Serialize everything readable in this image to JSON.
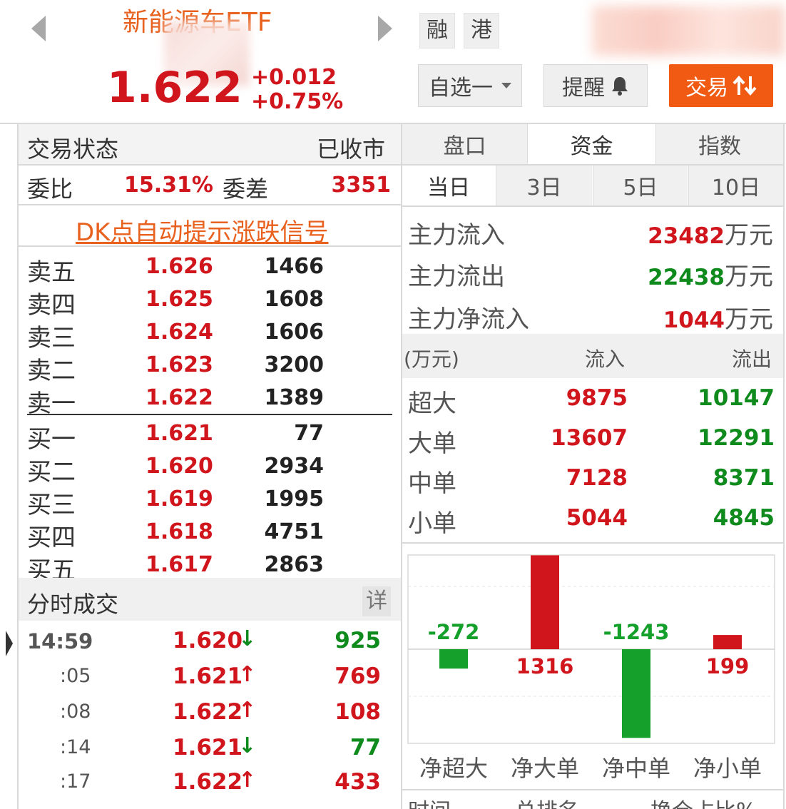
{
  "header": {
    "title": "新能源车ETF",
    "price": "1.622",
    "change": "+0.012",
    "change_pct": "+0.75%",
    "tag_margin": "融",
    "tag_hk": "港",
    "watchlist_label": "自选一",
    "alert_label": "提醒",
    "trade_label": "交易"
  },
  "status": {
    "label": "交易状态",
    "value": "已收市",
    "ratio_label": "委比",
    "ratio_value": "15.31%",
    "diff_label": "委差",
    "diff_value": "3351",
    "signal_link": "DK点自动提示涨跌信号"
  },
  "orderbook": {
    "asks": [
      {
        "name": "卖五",
        "price": "1.626",
        "vol": "1466"
      },
      {
        "name": "卖四",
        "price": "1.625",
        "vol": "1608"
      },
      {
        "name": "卖三",
        "price": "1.624",
        "vol": "1606"
      },
      {
        "name": "卖二",
        "price": "1.623",
        "vol": "3200"
      },
      {
        "name": "卖一",
        "price": "1.622",
        "vol": "1389"
      }
    ],
    "bids": [
      {
        "name": "买一",
        "price": "1.621",
        "vol": "77"
      },
      {
        "name": "买二",
        "price": "1.620",
        "vol": "2934"
      },
      {
        "name": "买三",
        "price": "1.619",
        "vol": "1995"
      },
      {
        "name": "买四",
        "price": "1.618",
        "vol": "4751"
      },
      {
        "name": "买五",
        "price": "1.617",
        "vol": "2863"
      }
    ]
  },
  "ticks": {
    "title": "分时成交",
    "detail": "详",
    "rows": [
      {
        "time": "14:59",
        "price": "1.620",
        "dir": "↓",
        "vol": "925",
        "color": "#0f8a1c"
      },
      {
        "time": ":05",
        "price": "1.621",
        "dir": "↑",
        "vol": "769",
        "color": "#d0161c"
      },
      {
        "time": ":08",
        "price": "1.622",
        "dir": "↑",
        "vol": "108",
        "color": "#d0161c"
      },
      {
        "time": ":14",
        "price": "1.621",
        "dir": "↓",
        "vol": "77",
        "color": "#0f8a1c"
      },
      {
        "time": ":17",
        "price": "1.622",
        "dir": "↑",
        "vol": "433",
        "color": "#d0161c"
      }
    ]
  },
  "tabs": {
    "main": [
      "盘口",
      "资金",
      "指数"
    ],
    "period": [
      "当日",
      "3日",
      "5日",
      "10日"
    ]
  },
  "fundflow": {
    "inflow_label": "主力流入",
    "inflow_value": "23482",
    "outflow_label": "主力流出",
    "outflow_value": "22438",
    "net_label": "主力净流入",
    "net_value": "1044",
    "unit": "万元",
    "table_unit": "(万元)",
    "col_in": "流入",
    "col_out": "流出",
    "rows": [
      {
        "name": "超大",
        "in": "9875",
        "out": "10147"
      },
      {
        "name": "大单",
        "in": "13607",
        "out": "12291"
      },
      {
        "name": "中单",
        "in": "7128",
        "out": "8371"
      },
      {
        "name": "小单",
        "in": "5044",
        "out": "4845"
      }
    ]
  },
  "footer_cols": [
    "时间",
    "总排名",
    "换仓占比%"
  ],
  "chart_data": {
    "type": "bar",
    "categories": [
      "净超大",
      "净大单",
      "净中单",
      "净小单"
    ],
    "values": [
      -272,
      1316,
      -1243,
      199
    ],
    "colors": {
      "positive": "#d0161c",
      "negative": "#14a02a"
    }
  }
}
